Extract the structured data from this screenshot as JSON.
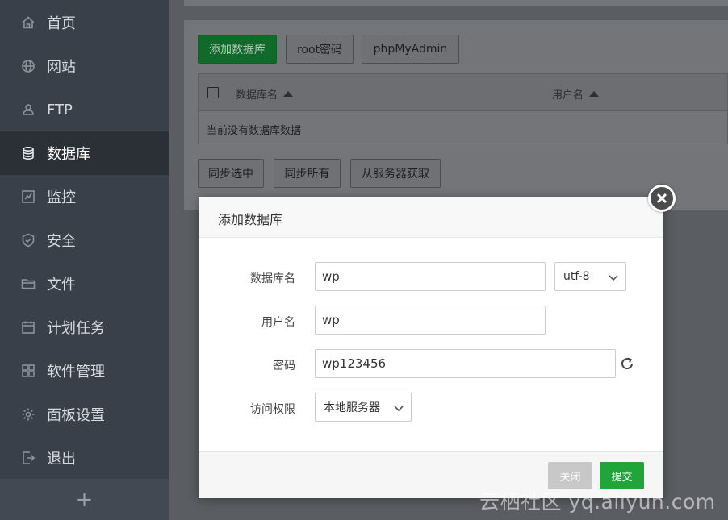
{
  "sidebar": {
    "items": [
      {
        "label": "首页",
        "icon": "home-icon"
      },
      {
        "label": "网站",
        "icon": "globe-icon"
      },
      {
        "label": "FTP",
        "icon": "ftp-icon"
      },
      {
        "label": "数据库",
        "icon": "database-icon",
        "active": true
      },
      {
        "label": "监控",
        "icon": "monitor-icon"
      },
      {
        "label": "安全",
        "icon": "shield-icon"
      },
      {
        "label": "文件",
        "icon": "folder-icon"
      },
      {
        "label": "计划任务",
        "icon": "calendar-icon"
      },
      {
        "label": "软件管理",
        "icon": "grid-icon"
      },
      {
        "label": "面板设置",
        "icon": "gear-icon"
      },
      {
        "label": "退出",
        "icon": "logout-icon"
      }
    ],
    "add_symbol": "+"
  },
  "toolbar": {
    "add_db": "添加数据库",
    "root_pwd": "root密码",
    "phpmyadmin": "phpMyAdmin"
  },
  "table": {
    "columns": [
      "数据库名",
      "用户名"
    ],
    "empty_text": "当前没有数据库数据"
  },
  "actions": {
    "sync_selected": "同步选中",
    "sync_all": "同步所有",
    "fetch_server": "从服务器获取"
  },
  "modal": {
    "title": "添加数据库",
    "fields": {
      "db_name_label": "数据库名",
      "db_name_value": "wp",
      "charset_value": "utf-8",
      "username_label": "用户名",
      "username_value": "wp",
      "password_label": "密码",
      "password_value": "wp123456",
      "access_label": "访问权限",
      "access_value": "本地服务器"
    },
    "close_label": "关闭",
    "submit_label": "提交"
  },
  "watermark": "云栖社区 yq.aliyun.com",
  "colors": {
    "accent_green": "#20a53a",
    "sidebar_bg": "#3a4049",
    "sidebar_active_bg": "#2b3037"
  }
}
